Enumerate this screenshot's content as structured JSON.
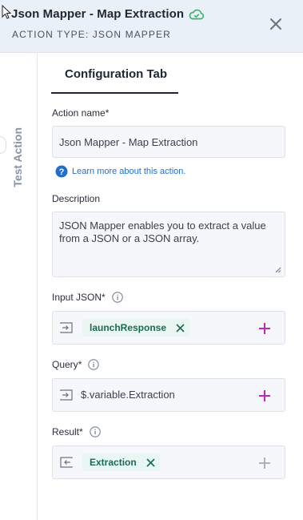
{
  "header": {
    "title": "Json Mapper - Map Extraction",
    "subtitle": "ACTION TYPE: JSON MAPPER"
  },
  "side_tab": {
    "label": "Test Action"
  },
  "tabs": [
    {
      "label": "Configuration Tab",
      "active": true
    }
  ],
  "form": {
    "action_name": {
      "label": "Action name",
      "required_mark": "*",
      "value": "Json Mapper - Map Extraction"
    },
    "help": {
      "link_text": "Learn more",
      "rest_text": "about this action."
    },
    "description": {
      "label": "Description",
      "value": "JSON Mapper enables you to extract a value from a JSON or a JSON array."
    },
    "input_json": {
      "label": "Input JSON",
      "required_mark": "*",
      "chip": "launchResponse"
    },
    "query": {
      "label": "Query",
      "required_mark": "*",
      "value": "$.variable.Extraction"
    },
    "result": {
      "label": "Result",
      "required_mark": "*",
      "chip": "Extraction"
    }
  },
  "colors": {
    "accent_plus": "#c026b8",
    "chip_bg": "#e9f6f1",
    "chip_text": "#1a6b55",
    "cloud": "#3cb371",
    "link": "#1f6fd1"
  }
}
